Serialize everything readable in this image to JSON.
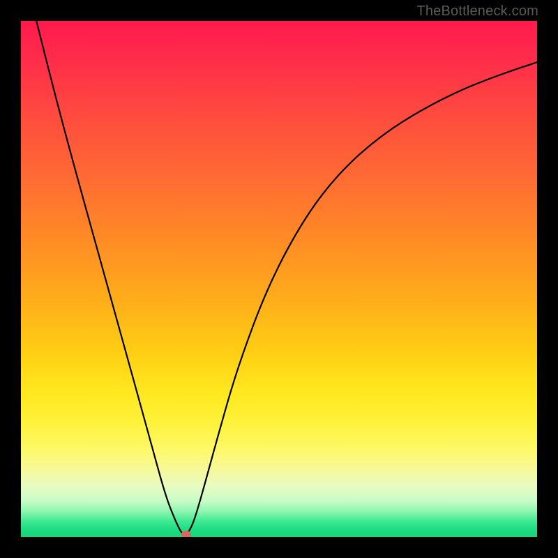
{
  "watermark": "TheBottleneck.com",
  "chart_data": {
    "type": "line",
    "title": "",
    "xlabel": "",
    "ylabel": "",
    "xlim": [
      0,
      100
    ],
    "ylim": [
      0,
      100
    ],
    "grid": false,
    "legend": false,
    "series": [
      {
        "name": "curve",
        "x": [
          3,
          6,
          10,
          15,
          20,
          25,
          28,
          30,
          31,
          31.5,
          32,
          32.5,
          33.5,
          35,
          38,
          42,
          48,
          55,
          62,
          70,
          78,
          86,
          94,
          100
        ],
        "y": [
          100,
          88,
          73,
          55,
          37,
          19,
          8,
          3,
          1,
          0.5,
          0.5,
          1,
          3,
          8,
          19,
          33,
          49,
          62,
          71,
          78,
          83,
          87,
          90,
          92
        ]
      }
    ],
    "marker": {
      "x": 32,
      "y": 0.5,
      "color": "#d66a5a",
      "r": 6
    },
    "background_gradient": {
      "type": "vertical",
      "stops": [
        {
          "pos": 0,
          "color": "#ff1a4d"
        },
        {
          "pos": 50,
          "color": "#ff9a20"
        },
        {
          "pos": 75,
          "color": "#ffe81f"
        },
        {
          "pos": 100,
          "color": "#18d47b"
        }
      ]
    }
  }
}
